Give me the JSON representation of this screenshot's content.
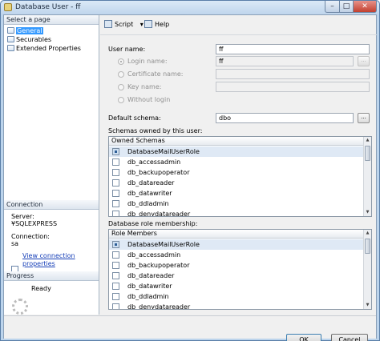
{
  "window": {
    "title": "Database User - ff",
    "minimize_glyph": "–",
    "maximize_glyph": "□",
    "close_glyph": "✕",
    "app_icon": "database-user-icon"
  },
  "left_pane": {
    "select_page_header": "Select a page",
    "pages": [
      {
        "label": "General",
        "selected": true
      },
      {
        "label": "Securables",
        "selected": false
      },
      {
        "label": "Extended Properties",
        "selected": false
      }
    ],
    "connection": {
      "header": "Connection",
      "server_label": "Server:",
      "server_value": "¥SQLEXPRESS",
      "connection_label": "Connection:",
      "connection_value": "sa",
      "view_link": "View connection properties"
    },
    "progress": {
      "header": "Progress",
      "status": "Ready"
    }
  },
  "toolbar": {
    "script_label": "Script",
    "script_dropdown_glyph": "▾",
    "help_label": "Help"
  },
  "form": {
    "user_name_label": "User name:",
    "user_name_value": "ff",
    "login_name_label": "Login name:",
    "login_name_value": "ff",
    "certificate_name_label": "Certificate name:",
    "key_name_label": "Key name:",
    "without_login_label": "Without login",
    "default_schema_label": "Default schema:",
    "default_schema_value": "dbo",
    "browse_glyph": "...",
    "schemas_owned_label": "Schemas owned by this user:",
    "owned_schemas_header": "Owned Schemas",
    "owned_schemas": [
      {
        "name": "DatabaseMailUserRole",
        "checked": true
      },
      {
        "name": "db_accessadmin",
        "checked": false
      },
      {
        "name": "db_backupoperator",
        "checked": false
      },
      {
        "name": "db_datareader",
        "checked": false
      },
      {
        "name": "db_datawriter",
        "checked": false
      },
      {
        "name": "db_ddladmin",
        "checked": false
      },
      {
        "name": "db_denydatareader",
        "checked": false
      }
    ],
    "role_membership_label": "Database role membership:",
    "role_members_header": "Role Members",
    "role_members": [
      {
        "name": "DatabaseMailUserRole",
        "checked": true
      },
      {
        "name": "db_accessadmin",
        "checked": false
      },
      {
        "name": "db_backupoperator",
        "checked": false
      },
      {
        "name": "db_datareader",
        "checked": false
      },
      {
        "name": "db_datawriter",
        "checked": false
      },
      {
        "name": "db_ddladmin",
        "checked": false
      },
      {
        "name": "db_denydatareader",
        "checked": false
      }
    ],
    "scroll_up_glyph": "▲",
    "scroll_down_glyph": "▼"
  },
  "buttons": {
    "ok": "OK",
    "cancel": "Cancel"
  }
}
